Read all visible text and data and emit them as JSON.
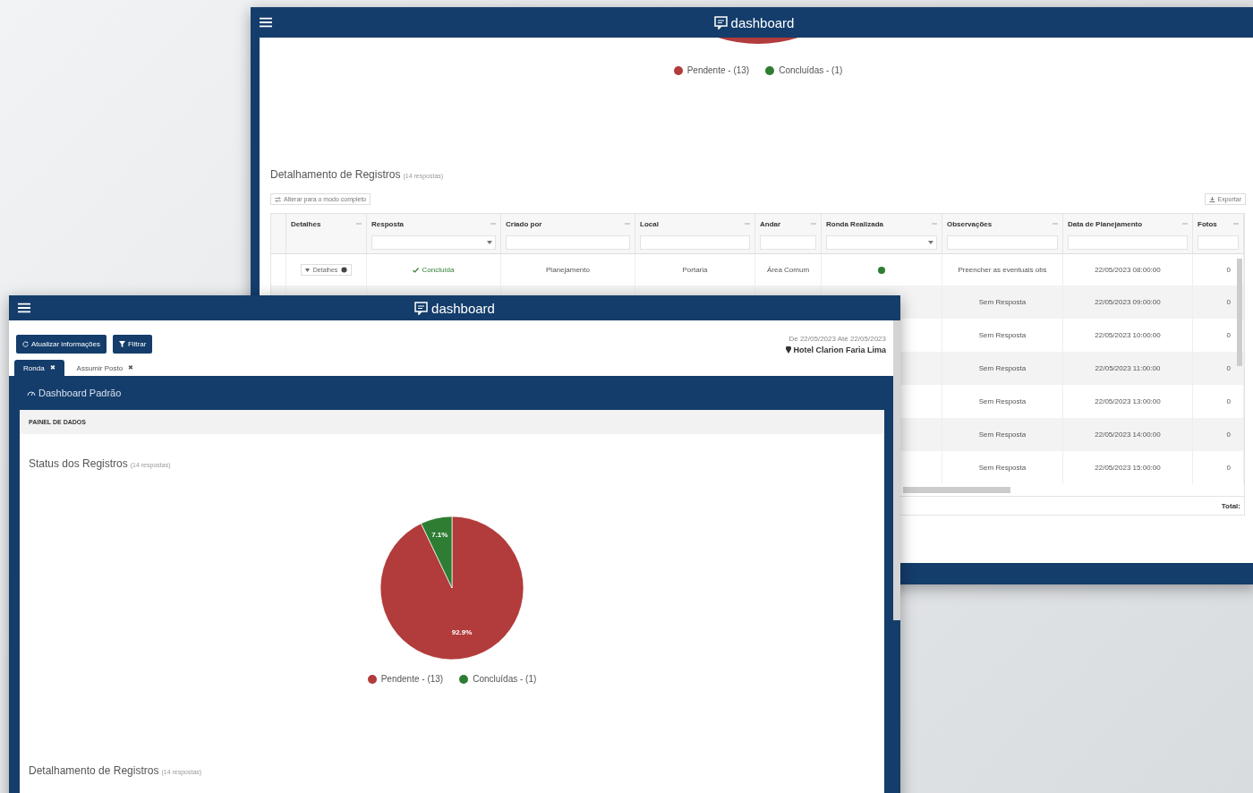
{
  "back_window": {
    "header": {
      "logo_text": "dashboard"
    },
    "section_title": "Detalhamento de Registros",
    "section_count": "(14 respostas)",
    "mode_button": "Alterar para o modo completo",
    "export_button": "Exportar",
    "legend": [
      {
        "label": "Pendente - (13)",
        "color": "#b23b3b"
      },
      {
        "label": "Concluídas - (1)",
        "color": "#2e7d32"
      }
    ],
    "table": {
      "columns": [
        {
          "label": "Detalhes",
          "kind": "plain"
        },
        {
          "label": "Resposta",
          "kind": "dropdown"
        },
        {
          "label": "Criado por",
          "kind": "text"
        },
        {
          "label": "Local",
          "kind": "text"
        },
        {
          "label": "Andar",
          "kind": "text"
        },
        {
          "label": "Ronda Realizada",
          "kind": "dropdown"
        },
        {
          "label": "Observações",
          "kind": "text"
        },
        {
          "label": "Data de Planejamento",
          "kind": "text"
        },
        {
          "label": "Fotos",
          "kind": "text"
        }
      ],
      "rows": [
        {
          "cells": [
            "Detalhes",
            "Concluída",
            "Planejamento",
            "Portaria",
            "Área Comum",
            "",
            "Preencher as eventuais obs",
            "22/05/2023 08:00:00",
            "0"
          ],
          "ronda_realizada": true
        },
        {
          "cells": [
            "",
            "",
            "",
            "",
            "",
            "",
            "Sem Resposta",
            "22/05/2023 09:00:00",
            "0"
          ]
        },
        {
          "cells": [
            "",
            "",
            "",
            "",
            "",
            "",
            "Sem Resposta",
            "22/05/2023 10:00:00",
            "0"
          ]
        },
        {
          "cells": [
            "",
            "",
            "",
            "",
            "",
            "",
            "Sem Resposta",
            "22/05/2023 11:00:00",
            "0"
          ]
        },
        {
          "cells": [
            "",
            "",
            "",
            "",
            "",
            "",
            "Sem Resposta",
            "22/05/2023 13:00:00",
            "0"
          ]
        },
        {
          "cells": [
            "",
            "",
            "",
            "",
            "",
            "",
            "Sem Resposta",
            "22/05/2023 14:00:00",
            "0"
          ]
        },
        {
          "cells": [
            "",
            "",
            "",
            "",
            "",
            "",
            "Sem Resposta",
            "22/05/2023 15:00:00",
            "0"
          ]
        }
      ],
      "footer": "Total:"
    }
  },
  "front_window": {
    "header": {
      "logo_text": "dashboard"
    },
    "buttons": [
      {
        "kind": "refresh",
        "label": "Atualizar informações"
      },
      {
        "kind": "filter",
        "label": "Filtrar"
      }
    ],
    "date_range": "De 22/05/2023 Até 22/05/2023",
    "location": "Hotel Clarion Faria Lima",
    "tabs": [
      {
        "label": "Ronda",
        "selected": true,
        "close": "✖"
      },
      {
        "label": "Assumir Posto",
        "selected": false,
        "close": "✖"
      }
    ],
    "dashboard_title": "Dashboard Padrão",
    "panel_title": "PAINEL DE DADOS",
    "chart_title": "Status dos Registros",
    "chart_count": "(14 respostas)",
    "chart_data": {
      "type": "pie",
      "categories": [
        "Pendente - (13)",
        "Concluídas - (1)"
      ],
      "values": [
        92.9,
        7.1
      ],
      "colors": [
        "#b23b3b",
        "#2e7d32"
      ],
      "value_labels": [
        "92.9%",
        "7.1%"
      ]
    },
    "detail_title": "Detalhamento de Registros",
    "detail_count": "(14 respostas)"
  }
}
